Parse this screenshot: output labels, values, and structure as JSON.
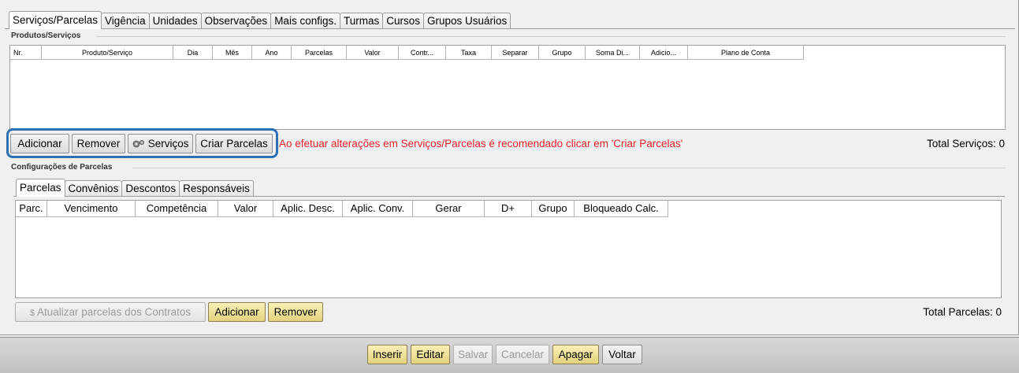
{
  "main_tabs": [
    "Serviços/Parcelas",
    "Vigência",
    "Unidades",
    "Observações",
    "Mais configs.",
    "Turmas",
    "Cursos",
    "Grupos Usuários"
  ],
  "produtos": {
    "title": "Produtos/Serviços",
    "columns": [
      "Nr.",
      "Produto/Serviço",
      "Dia",
      "Mês",
      "Ano",
      "Parcelas",
      "Valor",
      "Contr...",
      "Taxa",
      "Separar",
      "Grupo",
      "Soma Di...",
      "Adicio...",
      "Plano de Conta"
    ],
    "buttons": {
      "adicionar": "Adicionar",
      "remover": "Remover",
      "servicos": "Serviços",
      "criar_parcelas": "Criar Parcelas"
    },
    "warning": "Ao efetuar alterações em Serviços/Parcelas é recomendado clicar em 'Criar Parcelas'",
    "total": "Total Serviços: 0"
  },
  "parcelas_config": {
    "title": "Configurações de Parcelas",
    "tabs": [
      "Parcelas",
      "Convênios",
      "Descontos",
      "Responsáveis"
    ],
    "columns": [
      "Parc.",
      "Vencimento",
      "Competência",
      "Valor",
      "Aplic. Desc.",
      "Aplic. Conv.",
      "Gerar",
      "D+",
      "Grupo",
      "Bloqueado Calc."
    ],
    "buttons": {
      "atualizar": "Atualizar parcelas dos Contratos",
      "adicionar": "Adicionar",
      "remover": "Remover"
    },
    "total": "Total Parcelas: 0"
  },
  "footer": {
    "inserir": "Inserir",
    "editar": "Editar",
    "salvar": "Salvar",
    "cancelar": "Cancelar",
    "apagar": "Apagar",
    "voltar": "Voltar"
  },
  "colors": {
    "warning": "#e8232b",
    "highlight": "#2f6fb2",
    "yellow_button": "#ecdc8c"
  }
}
